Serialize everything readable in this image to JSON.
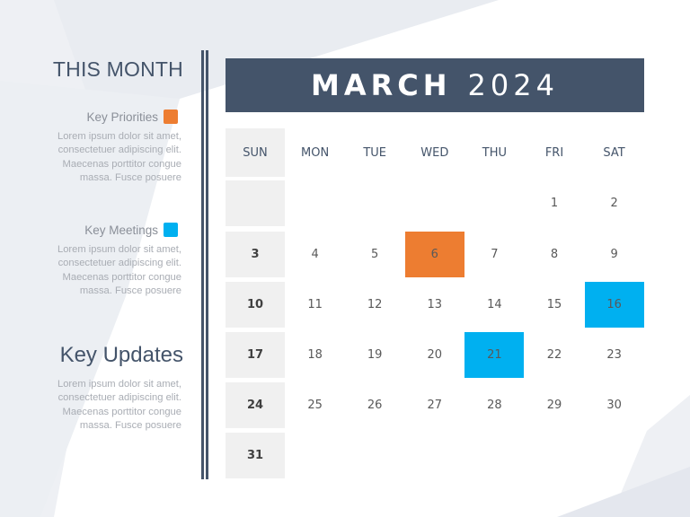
{
  "sidebar": {
    "title": "THIS MONTH",
    "sections": [
      {
        "label": "Key Priorities",
        "swatch_color": "#ed7d31",
        "body": "Lorem ipsum dolor sit amet, consectetuer adipiscing elit. Maecenas porttitor congue massa. Fusce posuere"
      },
      {
        "label": "Key Meetings",
        "swatch_color": "#00b0f0",
        "body": "Lorem ipsum dolor sit amet, consectetuer adipiscing elit. Maecenas porttitor congue massa. Fusce posuere"
      }
    ],
    "updates": {
      "title": "Key Updates",
      "body": "Lorem ipsum dolor sit amet, consectetuer adipiscing elit. Maecenas porttitor congue massa. Fusce posuere"
    }
  },
  "calendar": {
    "month": "MARCH",
    "year": "2024",
    "weekdays": [
      "SUN",
      "MON",
      "TUE",
      "WED",
      "THU",
      "FRI",
      "SAT"
    ],
    "weeks": [
      [
        "",
        "",
        "",
        "",
        "",
        "1",
        "2"
      ],
      [
        "3",
        "4",
        "5",
        "6",
        "7",
        "8",
        "9"
      ],
      [
        "10",
        "11",
        "12",
        "13",
        "14",
        "15",
        "16"
      ],
      [
        "17",
        "18",
        "19",
        "20",
        "21",
        "22",
        "23"
      ],
      [
        "24",
        "25",
        "26",
        "27",
        "28",
        "29",
        "30"
      ],
      [
        "31",
        "",
        "",
        "",
        "",
        "",
        ""
      ]
    ],
    "highlights": {
      "priority": [
        "6"
      ],
      "meeting": [
        "16",
        "21"
      ]
    }
  },
  "colors": {
    "header_bg": "#44546a",
    "priority": "#ed7d31",
    "meeting": "#00b0f0",
    "sunday_bg": "#f0f0f0"
  }
}
